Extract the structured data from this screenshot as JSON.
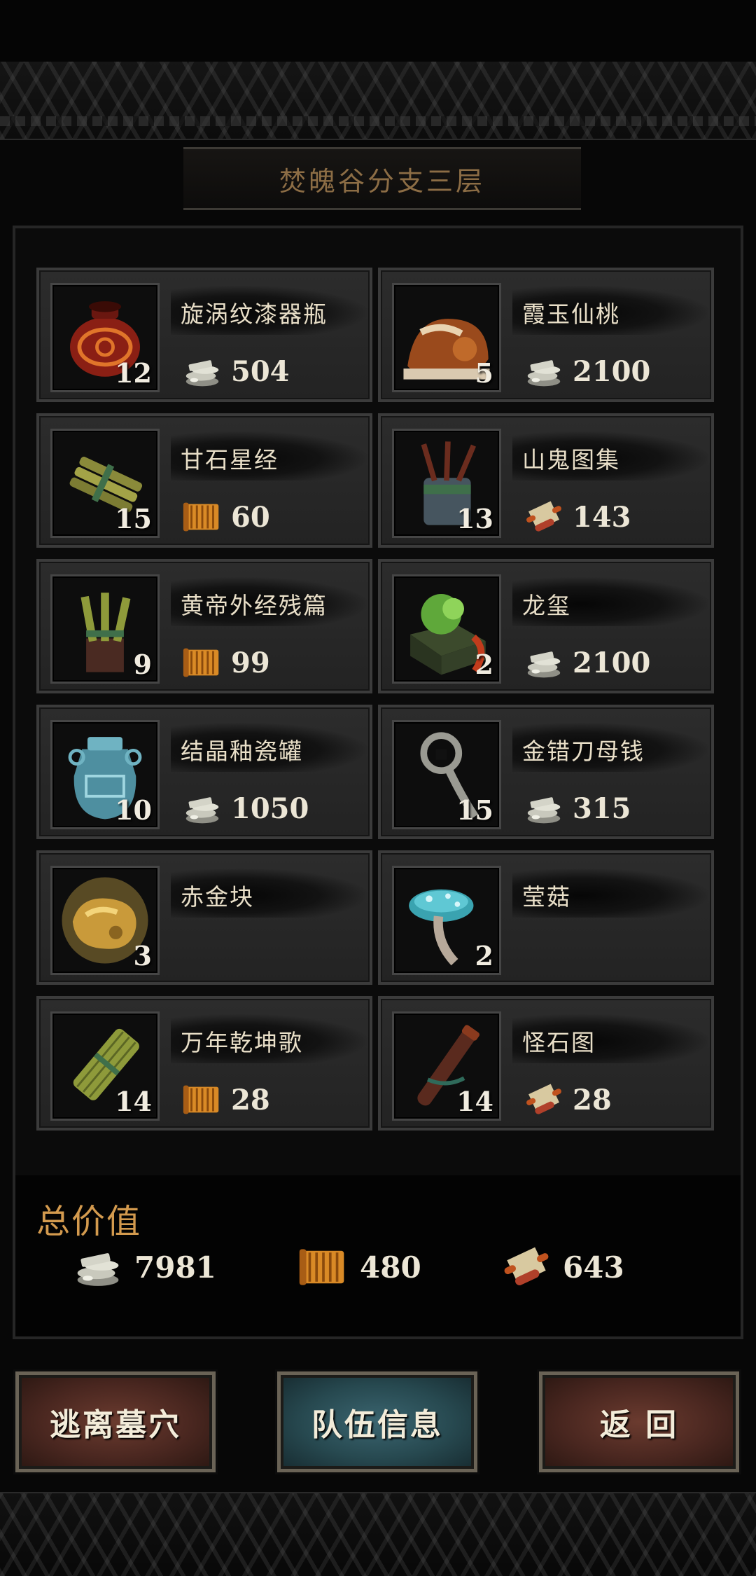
{
  "header": {
    "title": "焚魄谷分支三层"
  },
  "currency_icons": {
    "coin": "silver-coins-icon",
    "scroll": "orange-scroll-icon",
    "map": "map-scroll-icon"
  },
  "items": [
    {
      "name": "旋涡纹漆器瓶",
      "qty": "12",
      "currency": "coin",
      "price": "504",
      "icon": "lacquer-vase-icon"
    },
    {
      "name": "霞玉仙桃",
      "qty": "5",
      "currency": "coin",
      "price": "2100",
      "icon": "jade-peach-icon"
    },
    {
      "name": "甘石星经",
      "qty": "15",
      "currency": "scroll",
      "price": "60",
      "icon": "bamboo-scroll-bundle-icon"
    },
    {
      "name": "山鬼图集",
      "qty": "13",
      "currency": "map",
      "price": "143",
      "icon": "scroll-jar-icon"
    },
    {
      "name": "黄帝外经残篇",
      "qty": "9",
      "currency": "scroll",
      "price": "99",
      "icon": "bamboo-scroll-stand-icon"
    },
    {
      "name": "龙玺",
      "qty": "2",
      "currency": "coin",
      "price": "2100",
      "icon": "dragon-seal-icon"
    },
    {
      "name": "结晶釉瓷罐",
      "qty": "10",
      "currency": "coin",
      "price": "1050",
      "icon": "glazed-jar-icon"
    },
    {
      "name": "金错刀母钱",
      "qty": "15",
      "currency": "coin",
      "price": "315",
      "icon": "knife-coin-icon"
    },
    {
      "name": "赤金块",
      "qty": "3",
      "currency": "",
      "price": "",
      "icon": "gold-nugget-icon"
    },
    {
      "name": "莹菇",
      "qty": "2",
      "currency": "",
      "price": "",
      "icon": "glow-mushroom-icon"
    },
    {
      "name": "万年乾坤歌",
      "qty": "14",
      "currency": "scroll",
      "price": "28",
      "icon": "bamboo-scroll-icon"
    },
    {
      "name": "怪石图",
      "qty": "14",
      "currency": "map",
      "price": "28",
      "icon": "rolled-painting-icon"
    }
  ],
  "totals": {
    "label": "总价值",
    "coin": "7981",
    "scroll": "480",
    "map": "643"
  },
  "buttons": {
    "escape": "逃离墓穴",
    "team_info": "队伍信息",
    "back": "返 回"
  }
}
